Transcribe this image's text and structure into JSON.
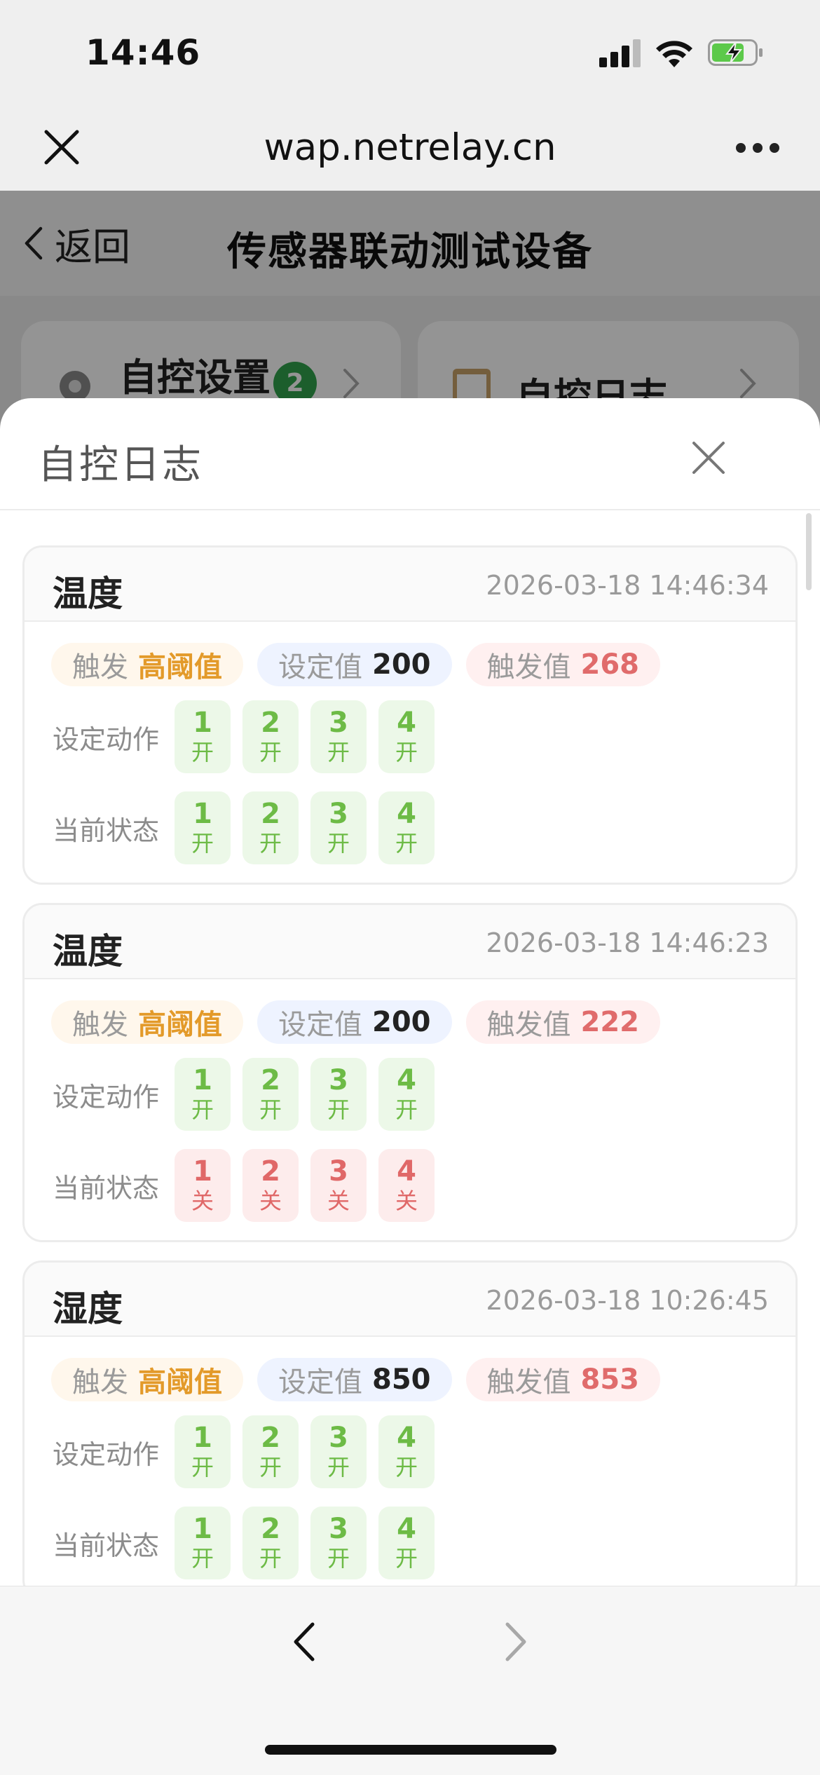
{
  "status_bar": {
    "time": "14:46"
  },
  "browser": {
    "url": "wap.netrelay.cn"
  },
  "app": {
    "back_label": "返回",
    "title": "传感器联动测试设备",
    "cards": [
      {
        "label": "自控设置",
        "badge": "2"
      },
      {
        "label": "自控日志"
      }
    ]
  },
  "sheet": {
    "title": "自控日志",
    "labels": {
      "trigger": "触发",
      "set_value": "设定值",
      "fire_value": "触发值",
      "set_action": "设定动作",
      "current_state": "当前状态"
    },
    "logs": [
      {
        "sensor": "温度",
        "time": "2026-03-18 14:46:34",
        "trigger_type": "高阈值",
        "set_value": "200",
        "fire_value": "268",
        "actions": [
          {
            "num": "1",
            "state": "开",
            "on": true
          },
          {
            "num": "2",
            "state": "开",
            "on": true
          },
          {
            "num": "3",
            "state": "开",
            "on": true
          },
          {
            "num": "4",
            "state": "开",
            "on": true
          }
        ],
        "status": [
          {
            "num": "1",
            "state": "开",
            "on": true
          },
          {
            "num": "2",
            "state": "开",
            "on": true
          },
          {
            "num": "3",
            "state": "开",
            "on": true
          },
          {
            "num": "4",
            "state": "开",
            "on": true
          }
        ]
      },
      {
        "sensor": "温度",
        "time": "2026-03-18 14:46:23",
        "trigger_type": "高阈值",
        "set_value": "200",
        "fire_value": "222",
        "actions": [
          {
            "num": "1",
            "state": "开",
            "on": true
          },
          {
            "num": "2",
            "state": "开",
            "on": true
          },
          {
            "num": "3",
            "state": "开",
            "on": true
          },
          {
            "num": "4",
            "state": "开",
            "on": true
          }
        ],
        "status": [
          {
            "num": "1",
            "state": "关",
            "on": false
          },
          {
            "num": "2",
            "state": "关",
            "on": false
          },
          {
            "num": "3",
            "state": "关",
            "on": false
          },
          {
            "num": "4",
            "state": "关",
            "on": false
          }
        ]
      },
      {
        "sensor": "湿度",
        "time": "2026-03-18 10:26:45",
        "trigger_type": "高阈值",
        "set_value": "850",
        "fire_value": "853",
        "actions": [
          {
            "num": "1",
            "state": "开",
            "on": true
          },
          {
            "num": "2",
            "state": "开",
            "on": true
          },
          {
            "num": "3",
            "state": "开",
            "on": true
          },
          {
            "num": "4",
            "state": "开",
            "on": true
          }
        ],
        "status": [
          {
            "num": "1",
            "state": "开",
            "on": true
          },
          {
            "num": "2",
            "state": "开",
            "on": true
          },
          {
            "num": "3",
            "state": "开",
            "on": true
          },
          {
            "num": "4",
            "state": "开",
            "on": true
          }
        ]
      }
    ]
  },
  "colors": {
    "on_text": "#6dbb46",
    "off_text": "#e06868",
    "trigger_value": "#e39a2a",
    "fire_value": "#e06b6b",
    "badge": "#31a24c",
    "battery_fill": "#5cc94a"
  }
}
